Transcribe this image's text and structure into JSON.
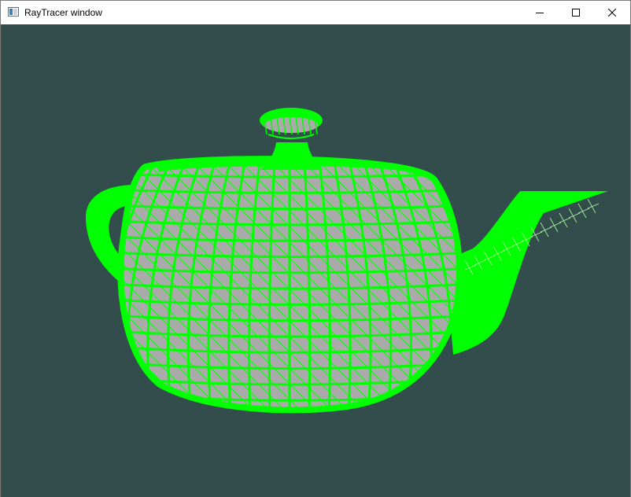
{
  "window": {
    "title": "RayTracer window",
    "background_color": "#334d4d",
    "wire_color": "#00ff00",
    "fill_color": "#aaaaaa"
  },
  "titlebar": {
    "icon": "app-window-icon",
    "controls": [
      "minimize-icon",
      "maximize-icon",
      "close-icon"
    ]
  },
  "scene": {
    "object": "teapot-wireframe-mesh"
  }
}
